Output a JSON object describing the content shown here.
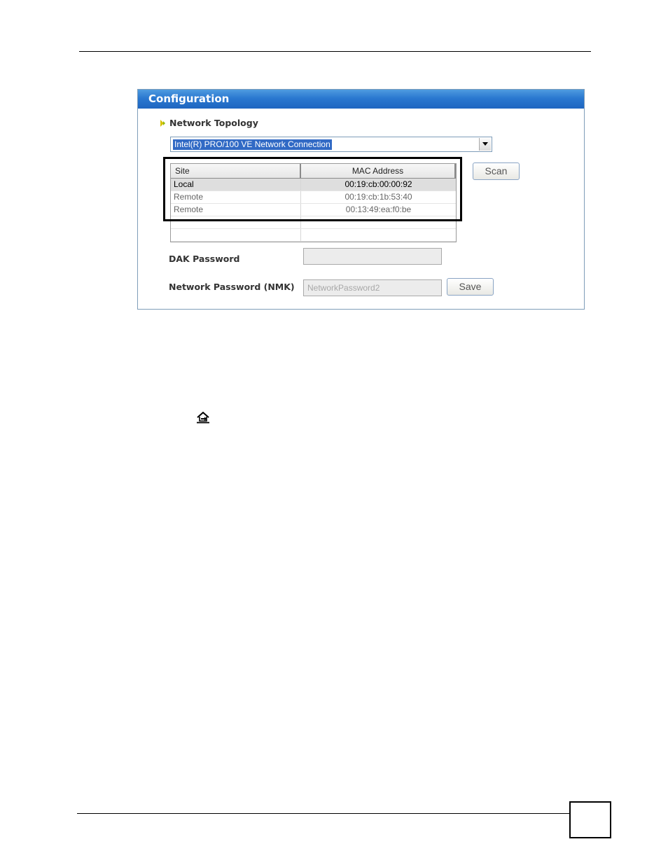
{
  "window": {
    "title": "Configuration",
    "section_label": "Network Topology",
    "adapter_select": {
      "value": "Intel(R) PRO/100 VE Network Connection"
    },
    "table": {
      "headers": {
        "site": "Site",
        "mac": "MAC Address"
      },
      "rows": [
        {
          "site": "Local",
          "mac": "00:19:cb:00:00:92"
        },
        {
          "site": "Remote",
          "mac": "00:19:cb:1b:53:40"
        },
        {
          "site": "Remote",
          "mac": "00:13:49:ea:f0:be"
        }
      ]
    },
    "scan_label": "Scan",
    "dak": {
      "label": "DAK Password",
      "value": ""
    },
    "nmk": {
      "label": "Network Password (NMK)",
      "placeholder": "NetworkPassword2"
    },
    "save_label": "Save"
  },
  "colors": {
    "title_bar": "#2a78d0",
    "selection": "#316ac5",
    "bullet": "#c8b400"
  },
  "icons": [
    "chevron-down-icon",
    "bullet-arrow-icon",
    "home-icon"
  ]
}
